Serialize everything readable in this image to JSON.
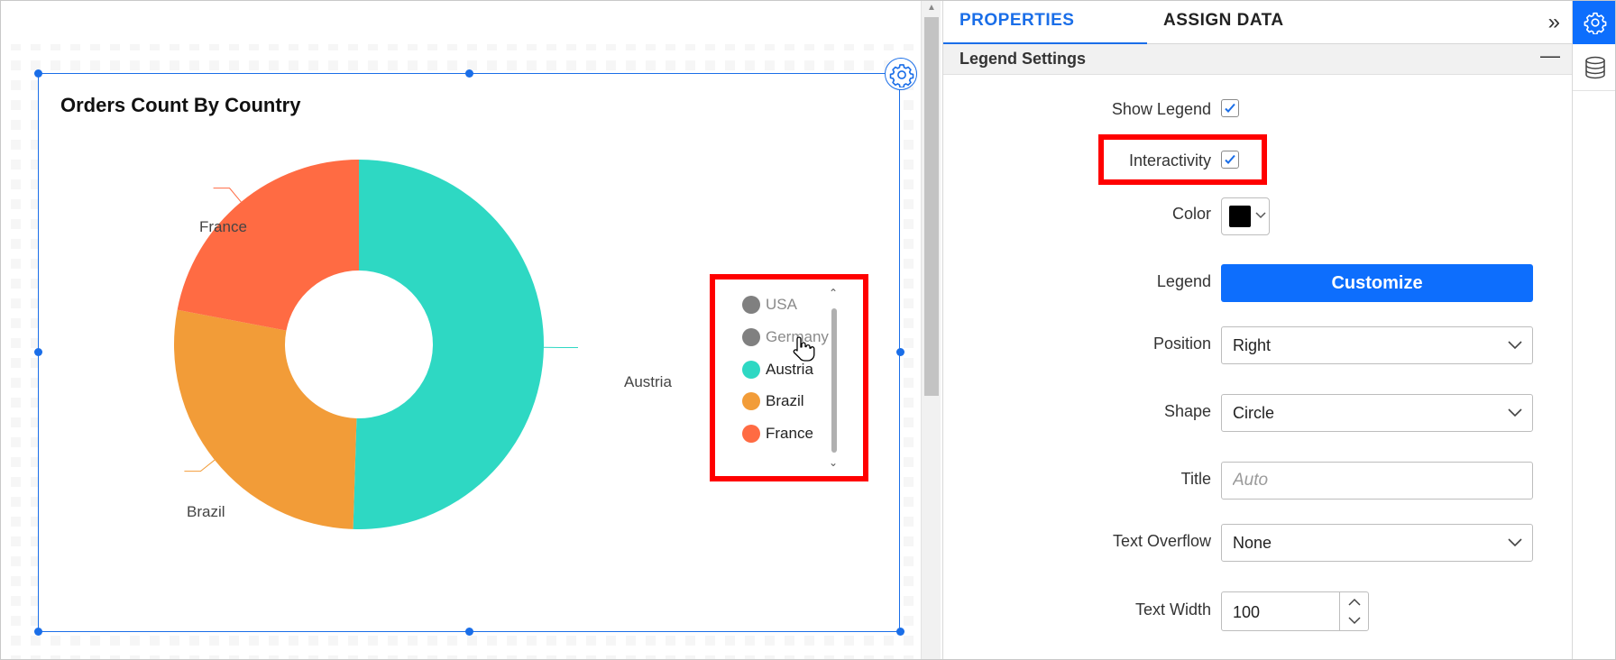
{
  "chart": {
    "title": "Orders Count By Country",
    "labels": {
      "austria": "Austria",
      "france": "France",
      "brazil": "Brazil"
    }
  },
  "legend": {
    "items": [
      {
        "label": "USA",
        "color": "#808080",
        "state": "hidden"
      },
      {
        "label": "Germany",
        "color": "#808080",
        "state": "hidden"
      },
      {
        "label": "Austria",
        "color": "#2ed8c3",
        "state": "visible"
      },
      {
        "label": "Brazil",
        "color": "#f29c38",
        "state": "visible"
      },
      {
        "label": "France",
        "color": "#ff6b43",
        "state": "visible"
      }
    ]
  },
  "panel": {
    "tabs": {
      "properties": "PROPERTIES",
      "assign_data": "ASSIGN DATA"
    },
    "section_title": "Legend Settings",
    "show_legend": {
      "label": "Show Legend",
      "checked": true
    },
    "interactivity": {
      "label": "Interactivity",
      "checked": true
    },
    "color": {
      "label": "Color",
      "value": "#000000"
    },
    "legend": {
      "label": "Legend",
      "button": "Customize"
    },
    "position": {
      "label": "Position",
      "value": "Right"
    },
    "shape": {
      "label": "Shape",
      "value": "Circle"
    },
    "title": {
      "label": "Title",
      "placeholder": "Auto"
    },
    "text_overflow": {
      "label": "Text Overflow",
      "value": "None"
    },
    "text_width": {
      "label": "Text Width",
      "value": "100"
    }
  },
  "chart_data": {
    "type": "pie",
    "title": "Orders Count By Country",
    "categories": [
      "Austria",
      "Brazil",
      "France"
    ],
    "values": [
      50.5,
      27.5,
      22.0
    ],
    "colors": [
      "#2ed8c3",
      "#f29c38",
      "#ff6b43"
    ],
    "legend": [
      "USA",
      "Germany",
      "Austria",
      "Brazil",
      "France"
    ],
    "hidden_legend_items": [
      "USA",
      "Germany"
    ],
    "legend_position": "right"
  }
}
